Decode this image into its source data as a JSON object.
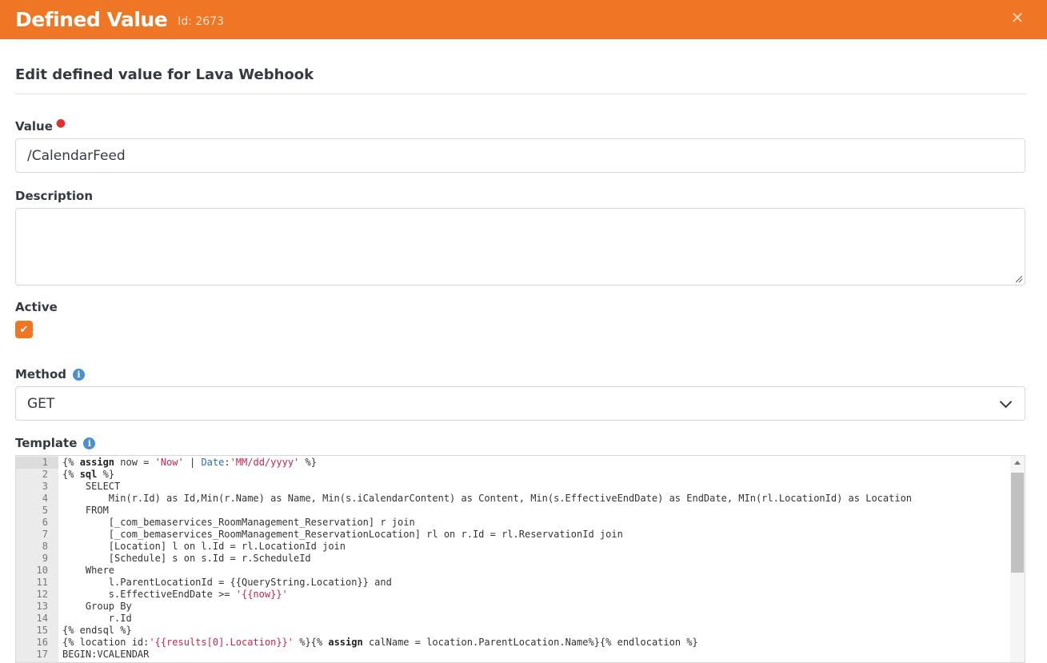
{
  "header": {
    "title": "Defined Value",
    "id_label": "Id: 2673",
    "close_icon": "close-icon",
    "color": "#ee7624"
  },
  "subtitle": "Edit defined value for Lava Webhook",
  "fields": {
    "value": {
      "label": "Value",
      "text": "/CalendarFeed"
    },
    "description": {
      "label": "Description",
      "text": ""
    },
    "active": {
      "label": "Active",
      "checked": true
    },
    "method": {
      "label": "Method",
      "selected": "GET"
    },
    "template": {
      "label": "Template"
    }
  },
  "editor": {
    "line_numbers": [
      "1",
      "2",
      "3",
      "4",
      "5",
      "6",
      "7",
      "8",
      "9",
      "10",
      "11",
      "12",
      "13",
      "14",
      "15",
      "16",
      "17"
    ],
    "lines": [
      "{% assign now = 'Now' | Date:'MM/dd/yyyy' %}",
      "{% sql %}",
      "    SELECT",
      "        Min(r.Id) as Id,Min(r.Name) as Name, Min(s.iCalendarContent) as Content, Min(s.EffectiveEndDate) as EndDate, MIn(rl.LocationId) as Location",
      "    FROM",
      "        [_com_bemaservices_RoomManagement_Reservation] r join",
      "        [_com_bemaservices_RoomManagement_ReservationLocation] rl on r.Id = rl.ReservationId join",
      "        [Location] l on l.Id = rl.LocationId join",
      "        [Schedule] s on s.Id = r.ScheduleId",
      "    Where",
      "        l.ParentLocationId = {{QueryString.Location}} and",
      "        s.EffectiveEndDate >= '{{now}}'",
      "    Group By",
      "        r.Id",
      "{% endsql %}",
      "{% location id:'{{results[0].Location}}' %}{% assign calName = location.ParentLocation.Name%}{% endlocation %}",
      "BEGIN:VCALENDAR"
    ]
  }
}
